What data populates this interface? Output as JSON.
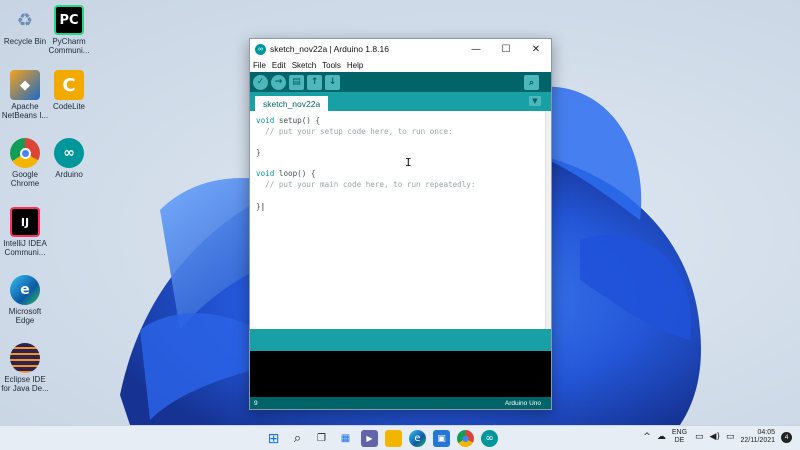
{
  "desktop": {
    "icons": [
      {
        "label": "Recycle Bin",
        "icon": "recycle-bin-icon"
      },
      {
        "label": "PyCharm\nCommuni...",
        "icon": "pycharm-icon"
      },
      {
        "label": "Apache\nNetBeans I...",
        "icon": "netbeans-icon"
      },
      {
        "label": "CodeLite",
        "icon": "codelite-icon"
      },
      {
        "label": "Google\nChrome",
        "icon": "chrome-icon"
      },
      {
        "label": "Arduino",
        "icon": "arduino-icon"
      },
      {
        "label": "IntelliJ IDEA\nCommuni...",
        "icon": "intellij-icon"
      },
      {
        "label": "Microsoft\nEdge",
        "icon": "edge-icon"
      },
      {
        "label": "Eclipse IDE\nfor Java De...",
        "icon": "eclipse-icon"
      }
    ],
    "icon_glyphs": {
      "pycharm": "PC",
      "codelite": "C",
      "intellij": "IJ"
    }
  },
  "window": {
    "title": "sketch_nov22a | Arduino 1.8.16",
    "controls": {
      "minimize": "—",
      "maximize": "☐",
      "close": "✕"
    },
    "menu": [
      "File",
      "Edit",
      "Sketch",
      "Tools",
      "Help"
    ],
    "toolbar": [
      {
        "name": "verify",
        "glyph": "✓"
      },
      {
        "name": "upload",
        "glyph": "→"
      },
      {
        "name": "new",
        "glyph": "▤"
      },
      {
        "name": "open",
        "glyph": "↑"
      },
      {
        "name": "save",
        "glyph": "↓"
      }
    ],
    "serial_monitor_glyph": "⌕",
    "tab": "sketch_nov22a",
    "tab_menu_glyph": "▼",
    "code": {
      "line1_kw": "void",
      "line1_rest": " setup() {",
      "line2": "  // put your setup code here, to run once:",
      "line3": "",
      "line4": "}",
      "line5": "",
      "line6_kw": "void",
      "line6_rest": " loop() {",
      "line7": "  // put your main code here, to run repeatedly:",
      "line8": "",
      "line9": "}"
    },
    "status": {
      "line": "9",
      "board": "Arduino Uno"
    }
  },
  "taskbar": {
    "apps": [
      {
        "name": "start",
        "glyph": "⊞",
        "color": "#1a73e8"
      },
      {
        "name": "search",
        "glyph": "⌕",
        "color": "#1f1f1f"
      },
      {
        "name": "task-view",
        "glyph": "❐",
        "color": "#1f1f1f"
      },
      {
        "name": "widgets",
        "glyph": "▦",
        "color": "#1a73e8"
      },
      {
        "name": "chat",
        "glyph": "▶",
        "color": "#6264a7"
      },
      {
        "name": "file-explorer",
        "glyph": "▬",
        "color": "#f2b600"
      },
      {
        "name": "edge",
        "glyph": "e",
        "color": "#0f7bd0"
      },
      {
        "name": "store",
        "glyph": "▣",
        "color": "#2577d6"
      },
      {
        "name": "chrome",
        "glyph": "●",
        "color": "#db4437"
      },
      {
        "name": "arduino",
        "glyph": "∞",
        "color": "#00979c"
      }
    ],
    "tray": {
      "chevron": "^",
      "cloud": "☁",
      "lang_top": "ENG",
      "lang_bottom": "DE",
      "network": "▭",
      "volume": "◀)",
      "battery": "▭",
      "time": "04:05",
      "date": "22/11/2021",
      "notifications": "4"
    }
  }
}
